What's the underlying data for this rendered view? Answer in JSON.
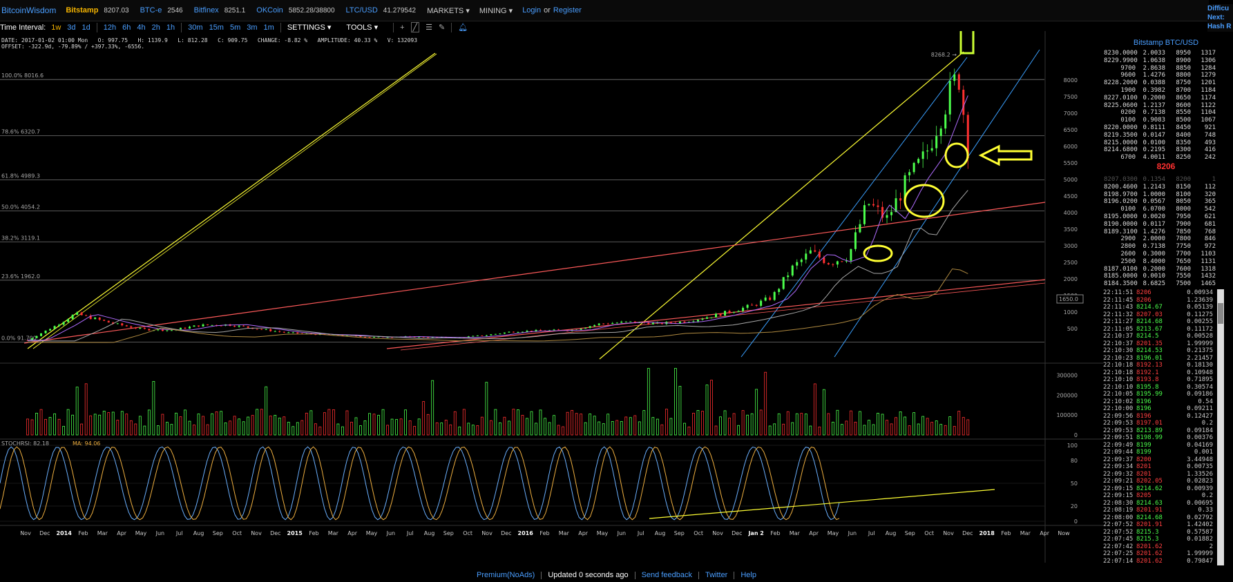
{
  "header": {
    "logo": "BitcoinWisdom",
    "exchanges": [
      {
        "name": "Bitstamp",
        "price": "8207.03",
        "active": true
      },
      {
        "name": "BTC-e",
        "price": "2546"
      },
      {
        "name": "Bitfinex",
        "price": "8251.1"
      },
      {
        "name": "OKCoin",
        "price": "5852.28/38800"
      },
      {
        "name": "LTC/USD",
        "price": "41.279542"
      }
    ],
    "menus": [
      "MARKETS",
      "MINING"
    ],
    "login": "Login",
    "or": "or",
    "register": "Register"
  },
  "toolbar": {
    "label": "Time Interval:",
    "intervals": [
      "1w",
      "3d",
      "1d",
      "12h",
      "6h",
      "4h",
      "2h",
      "1h",
      "30m",
      "15m",
      "5m",
      "3m",
      "1m"
    ],
    "active": "1w",
    "settings": "SETTINGS",
    "tools": "TOOLS",
    "tool_icons": [
      "plus-icon",
      "line-icon",
      "hline-icon",
      "brush-icon",
      "bell-icon"
    ]
  },
  "info": {
    "line1": "DATE: 2017-01-02 01:00 Mon   O: 997.75   H: 1139.9   L: 812.28   C: 909.75   CHANGE: -8.82 %   AMPLITUDE: 40.33 %   V: 132093",
    "line2": "OFFSET: -322.9d, -79.89% / +397.33%, -6556."
  },
  "chart_data": [
    {
      "type": "candlestick",
      "title": "",
      "x_labels": [
        "Nov",
        "Dec",
        "2014",
        "Feb",
        "Mar",
        "Apr",
        "May",
        "Jun",
        "Jul",
        "Aug",
        "Sep",
        "Oct",
        "Nov",
        "Dec",
        "2015",
        "Feb",
        "Mar",
        "Apr",
        "May",
        "Jun",
        "Jul",
        "Aug",
        "Sep",
        "Oct",
        "Nov",
        "Dec",
        "2016",
        "Feb",
        "Mar",
        "Apr",
        "May",
        "Jun",
        "Jul",
        "Aug",
        "Sep",
        "Oct",
        "Nov",
        "Dec",
        "Jan 2",
        "Feb",
        "Mar",
        "Apr",
        "May",
        "Jun",
        "Jul",
        "Aug",
        "Sep",
        "Oct",
        "Nov",
        "Dec",
        "2018",
        "Feb",
        "Mar",
        "Apr",
        "Now"
      ],
      "y_ticks": [
        500,
        1000,
        1500,
        2000,
        2500,
        3000,
        3500,
        4000,
        4500,
        5000,
        5500,
        6000,
        6500,
        7000,
        7500,
        8000
      ],
      "ylim": [
        0,
        8500
      ],
      "fib_levels": [
        {
          "label": "100.0% 8016.6",
          "value": 8016.6
        },
        {
          "label": "78.6% 6320.7",
          "value": 6320.7
        },
        {
          "label": "61.8% 4989.3",
          "value": 4989.3
        },
        {
          "label": "50.0% 4054.2",
          "value": 4054.2
        },
        {
          "label": "38.2% 3119.1",
          "value": 3119.1
        },
        {
          "label": "23.6% 1962.0",
          "value": 1962.0
        },
        {
          "label": "0.0% 91.700",
          "value": 91.7
        }
      ],
      "price_label": "8268.2",
      "cursor_label": "1650.0",
      "weekly_closes": [
        {
          "t": 0.0,
          "p": 150
        },
        {
          "t": 0.03,
          "p": 600
        },
        {
          "t": 0.05,
          "p": 950
        },
        {
          "t": 0.07,
          "p": 800
        },
        {
          "t": 0.09,
          "p": 650
        },
        {
          "t": 0.12,
          "p": 480
        },
        {
          "t": 0.15,
          "p": 450
        },
        {
          "t": 0.18,
          "p": 600
        },
        {
          "t": 0.21,
          "p": 620
        },
        {
          "t": 0.24,
          "p": 500
        },
        {
          "t": 0.27,
          "p": 380
        },
        {
          "t": 0.3,
          "p": 330
        },
        {
          "t": 0.33,
          "p": 300
        },
        {
          "t": 0.36,
          "p": 240
        },
        {
          "t": 0.39,
          "p": 260
        },
        {
          "t": 0.42,
          "p": 240
        },
        {
          "t": 0.45,
          "p": 230
        },
        {
          "t": 0.48,
          "p": 300
        },
        {
          "t": 0.51,
          "p": 420
        },
        {
          "t": 0.54,
          "p": 440
        },
        {
          "t": 0.57,
          "p": 460
        },
        {
          "t": 0.6,
          "p": 650
        },
        {
          "t": 0.63,
          "p": 700
        },
        {
          "t": 0.66,
          "p": 650
        },
        {
          "t": 0.69,
          "p": 720
        },
        {
          "t": 0.72,
          "p": 900
        },
        {
          "t": 0.74,
          "p": 1050
        },
        {
          "t": 0.76,
          "p": 1200
        },
        {
          "t": 0.78,
          "p": 1450
        },
        {
          "t": 0.8,
          "p": 2300
        },
        {
          "t": 0.82,
          "p": 2800
        },
        {
          "t": 0.84,
          "p": 2500
        },
        {
          "t": 0.86,
          "p": 2700
        },
        {
          "t": 0.88,
          "p": 4300
        },
        {
          "t": 0.9,
          "p": 3800
        },
        {
          "t": 0.92,
          "p": 4900
        },
        {
          "t": 0.94,
          "p": 5700
        },
        {
          "t": 0.96,
          "p": 7200
        },
        {
          "t": 0.975,
          "p": 8200
        },
        {
          "t": 0.985,
          "p": 6000
        }
      ],
      "volume_ticks": [
        0,
        100000,
        200000,
        300000
      ],
      "stochrsi": {
        "label": "STOCHRSI: 82.18",
        "ma_label": "MA: 94.06",
        "ticks": [
          0,
          20,
          50,
          80,
          100
        ]
      }
    }
  ],
  "orderbook": {
    "title": "Bitstamp BTC/USD",
    "mid": "8206",
    "asks": [
      [
        "8230.0000",
        "2.0033",
        "8950",
        "1317"
      ],
      [
        "8229.9900",
        "1.0638",
        "8900",
        "1306"
      ],
      [
        "9700",
        "2.8638",
        "8850",
        "1284"
      ],
      [
        "9600",
        "1.4276",
        "8800",
        "1279"
      ],
      [
        "8228.2000",
        "0.0388",
        "8750",
        "1201"
      ],
      [
        "1900",
        "0.3982",
        "8700",
        "1184"
      ],
      [
        "8227.0100",
        "0.2000",
        "8650",
        "1174"
      ],
      [
        "8225.0600",
        "1.2137",
        "8600",
        "1122"
      ],
      [
        "0200",
        "0.7138",
        "8550",
        "1104"
      ],
      [
        "0100",
        "0.9083",
        "8500",
        "1067"
      ],
      [
        "8220.0000",
        "0.8111",
        "8450",
        "921"
      ],
      [
        "8219.3500",
        "0.0147",
        "8400",
        "748"
      ],
      [
        "8215.0000",
        "0.0100",
        "8350",
        "493"
      ],
      [
        "8214.6800",
        "0.2195",
        "8300",
        "416"
      ],
      [
        "6700",
        "4.0011",
        "8250",
        "242"
      ]
    ],
    "bids": [
      [
        "8207.0300",
        "0.1354",
        "8200",
        "1"
      ],
      [
        "8200.4600",
        "1.2143",
        "8150",
        "112"
      ],
      [
        "8198.9700",
        "1.0000",
        "8100",
        "320"
      ],
      [
        "8196.0200",
        "0.0567",
        "8050",
        "365"
      ],
      [
        "0100",
        "6.0700",
        "8000",
        "542"
      ],
      [
        "8195.0000",
        "0.0020",
        "7950",
        "621"
      ],
      [
        "8190.0000",
        "0.0117",
        "7900",
        "681"
      ],
      [
        "8189.3100",
        "1.4276",
        "7850",
        "768"
      ],
      [
        "2900",
        "2.0000",
        "7800",
        "846"
      ],
      [
        "2800",
        "0.7138",
        "7750",
        "972"
      ],
      [
        "2600",
        "0.3000",
        "7700",
        "1103"
      ],
      [
        "2500",
        "8.4000",
        "7650",
        "1131"
      ],
      [
        "8187.0100",
        "0.2000",
        "7600",
        "1318"
      ],
      [
        "8185.0000",
        "0.0010",
        "7550",
        "1432"
      ],
      [
        "8184.3500",
        "8.6825",
        "7500",
        "1465"
      ]
    ]
  },
  "trades": [
    [
      "22:11:51",
      "8206",
      "down",
      "0.00934"
    ],
    [
      "22:11:45",
      "8206",
      "down",
      "1.23639"
    ],
    [
      "22:11:43",
      "8214.67",
      "up",
      "0.05139"
    ],
    [
      "22:11:32",
      "8207.03",
      "down",
      "0.11275"
    ],
    [
      "22:11:27",
      "8214.68",
      "up",
      "0.00255"
    ],
    [
      "22:11:05",
      "8213.67",
      "up",
      "0.11172"
    ],
    [
      "22:10:37",
      "8214.5",
      "up",
      "0.00528"
    ],
    [
      "22:10:37",
      "8201.35",
      "down",
      "1.99999"
    ],
    [
      "22:10:30",
      "8214.53",
      "up",
      "0.21375"
    ],
    [
      "22:10:23",
      "8196.01",
      "up",
      "2.21457"
    ],
    [
      "22:10:18",
      "8192.13",
      "down",
      "0.18130"
    ],
    [
      "22:10:18",
      "8192.1",
      "down",
      "0.10948"
    ],
    [
      "22:10:10",
      "8193.8",
      "down",
      "0.71895"
    ],
    [
      "22:10:10",
      "8195.8",
      "up",
      "0.30574"
    ],
    [
      "22:10:05",
      "8195.99",
      "up",
      "0.09186"
    ],
    [
      "22:10:02",
      "8196",
      "up",
      "0.54"
    ],
    [
      "22:10:00",
      "8196",
      "up",
      "0.09211"
    ],
    [
      "22:09:56",
      "8196",
      "down",
      "0.12427"
    ],
    [
      "22:09:53",
      "8197.01",
      "down",
      "0.2"
    ],
    [
      "22:09:53",
      "8213.89",
      "up",
      "0.09184"
    ],
    [
      "22:09:51",
      "8198.99",
      "up",
      "0.00376"
    ],
    [
      "22:09:49",
      "8199",
      "up",
      "0.04169"
    ],
    [
      "22:09:44",
      "8199",
      "up",
      "0.001"
    ],
    [
      "22:09:37",
      "8200",
      "down",
      "3.44948"
    ],
    [
      "22:09:34",
      "8201",
      "down",
      "0.00735"
    ],
    [
      "22:09:32",
      "8201",
      "down",
      "1.33526"
    ],
    [
      "22:09:21",
      "8202.05",
      "down",
      "0.02823"
    ],
    [
      "22:09:15",
      "8214.62",
      "up",
      "0.00939"
    ],
    [
      "22:09:15",
      "8205",
      "down",
      "0.2"
    ],
    [
      "22:08:30",
      "8214.63",
      "up",
      "0.00695"
    ],
    [
      "22:08:19",
      "8201.91",
      "down",
      "0.33"
    ],
    [
      "22:08:00",
      "8214.68",
      "up",
      "0.02792"
    ],
    [
      "22:07:52",
      "8201.91",
      "down",
      "1.42402"
    ],
    [
      "22:07:52",
      "8215.3",
      "up",
      "0.57587"
    ],
    [
      "22:07:45",
      "8215.3",
      "up",
      "0.01882"
    ],
    [
      "22:07:42",
      "8201.62",
      "down",
      "2"
    ],
    [
      "22:07:25",
      "8201.62",
      "down",
      "1.99999"
    ],
    [
      "22:07:14",
      "8201.62",
      "down",
      "0.79847"
    ]
  ],
  "rightbox": [
    "Difficu",
    "Next:",
    "Hash R"
  ],
  "footer": {
    "items": [
      "Premium(NoAds)",
      "Updated 0 seconds ago",
      "Send feedback",
      "Twitter",
      "Help"
    ]
  },
  "colors": {
    "accent": "#4a9eff",
    "up": "#4cff4c",
    "down": "#ff4040",
    "fib": "#888888",
    "yellow": "#ffff33",
    "blue": "#3aa0ff",
    "trend": "#ff5a5a"
  }
}
